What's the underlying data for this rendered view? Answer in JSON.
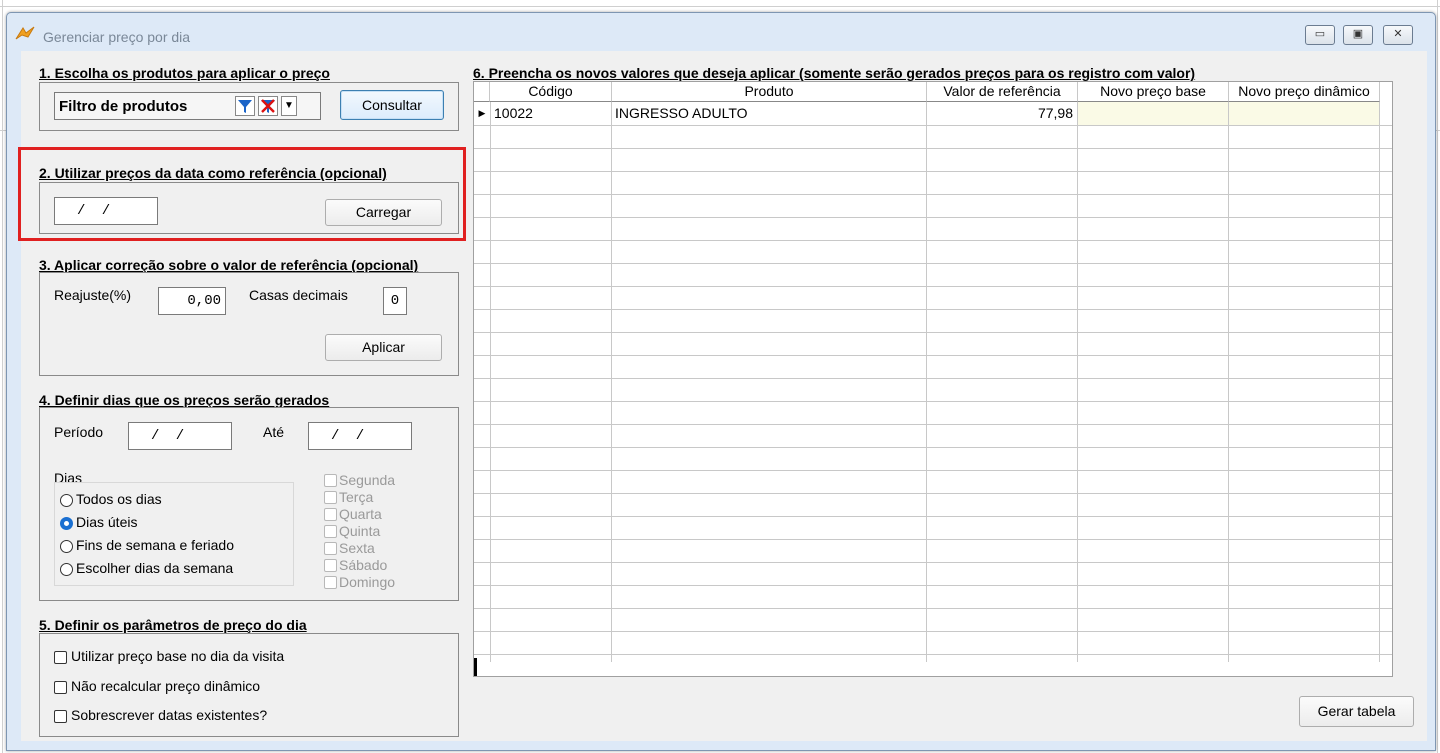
{
  "window": {
    "title": "Gerenciar preço por dia"
  },
  "section1": {
    "title": "1. Escolha os produtos para aplicar o preço",
    "filter_label": "Filtro de produtos",
    "consult_label": "Consultar"
  },
  "section2": {
    "title": "2. Utilizar preços da data como referência (opcional)",
    "date_value": "/ /",
    "load_label": "Carregar"
  },
  "section3": {
    "title": "3. Aplicar correção sobre o valor de referência (opcional)",
    "adjust_label": "Reajuste(%)",
    "adjust_value": "0,00",
    "decimals_label": "Casas decimais",
    "decimals_value": "0",
    "apply_label": "Aplicar"
  },
  "section4": {
    "title": "4. Definir dias que os preços serão gerados",
    "period_label": "Período",
    "period_value": "/ /",
    "until_label": "Até",
    "until_value": "/ /",
    "days_label": "Dias",
    "radio_options": [
      "Todos os dias",
      "Dias úteis",
      "Fins de semana e feriado",
      "Escolher dias da semana"
    ],
    "selected_radio": "Dias úteis",
    "weekdays": [
      "Segunda",
      "Terça",
      "Quarta",
      "Quinta",
      "Sexta",
      "Sábado",
      "Domingo"
    ]
  },
  "section5": {
    "title": "5. Definir os parâmetros de preço do dia",
    "options": [
      "Utilizar preço base no dia da visita",
      "Não recalcular preço dinâmico",
      "Sobrescrever datas existentes?"
    ]
  },
  "section6": {
    "title": "6. Preencha os novos valores que deseja aplicar (somente serão gerados preços para os registro com valor)",
    "columns": [
      "Código",
      "Produto",
      "Valor de referência",
      "Novo preço base",
      "Novo preço dinâmico"
    ],
    "rows": [
      {
        "codigo": "10022",
        "produto": "INGRESSO ADULTO",
        "valor_referencia": "77,98",
        "novo_preco_base": "",
        "novo_preco_dinamico": ""
      }
    ]
  },
  "footer": {
    "generate_label": "Gerar tabela"
  },
  "colors": {
    "highlight_box": "#e02020",
    "selected_radio": "#1a6fd1",
    "editable_cell": "#fafae6"
  }
}
